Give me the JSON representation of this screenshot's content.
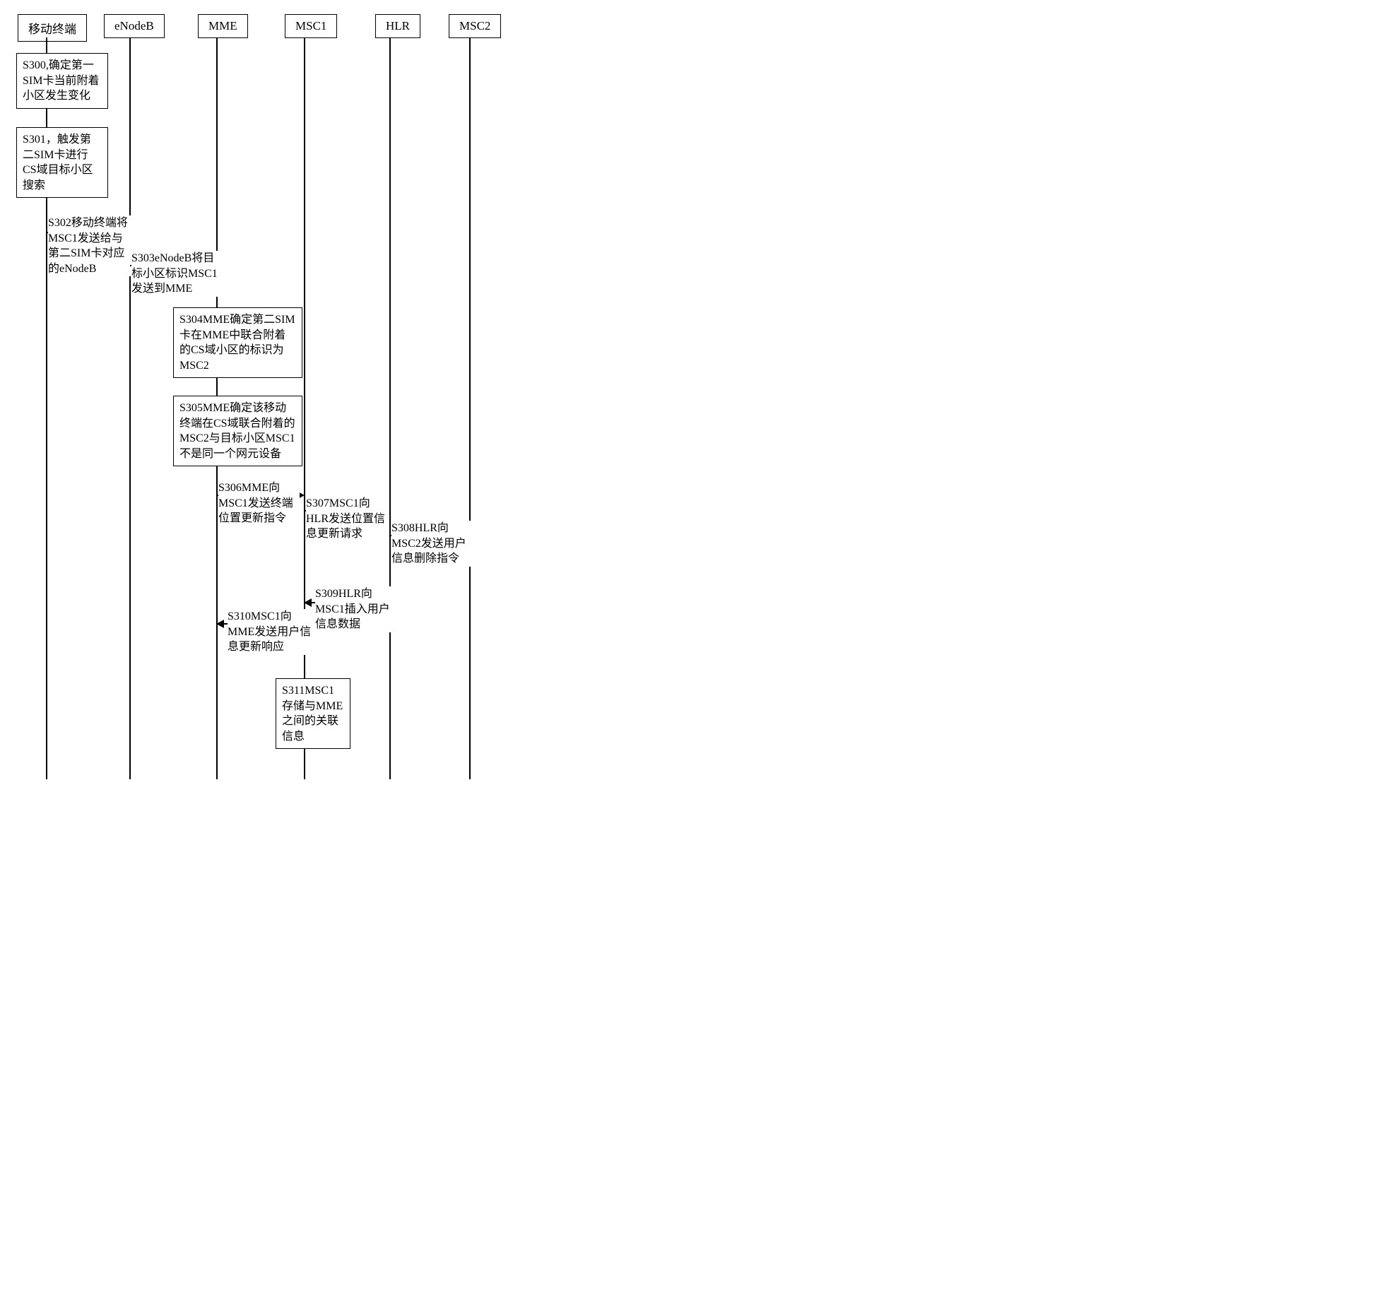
{
  "participants": {
    "terminal": "移动终端",
    "enodeb": "eNodeB",
    "mme": "MME",
    "msc1": "MSC1",
    "hlr": "HLR",
    "msc2": "MSC2"
  },
  "steps": {
    "s300": "S300,确定第一SIM卡当前附着小区发生变化",
    "s301": "S301，触发第二SIM卡进行CS域目标小区搜索",
    "s302": "S302移动终端将MSC1发送给与第二SIM卡对应的eNodeB",
    "s303": "S303eNodeB将目标小区标识MSC1发送到MME",
    "s304": "S304MME确定第二SIM卡在MME中联合附着的CS域小区的标识为MSC2",
    "s305": "S305MME确定该移动终端在CS域联合附着的MSC2与目标小区MSC1不是同一个网元设备",
    "s306": "S306MME向MSC1发送终端位置更新指令",
    "s307": "S307MSC1向HLR发送位置信息更新请求",
    "s308": "S308HLR向MSC2发送用户信息删除指令",
    "s309": "S309HLR向MSC1插入用户信息数据",
    "s310": "S310MSC1向MME发送用户信息更新响应",
    "s311": "S311MSC1存储与MME之间的关联信息"
  }
}
